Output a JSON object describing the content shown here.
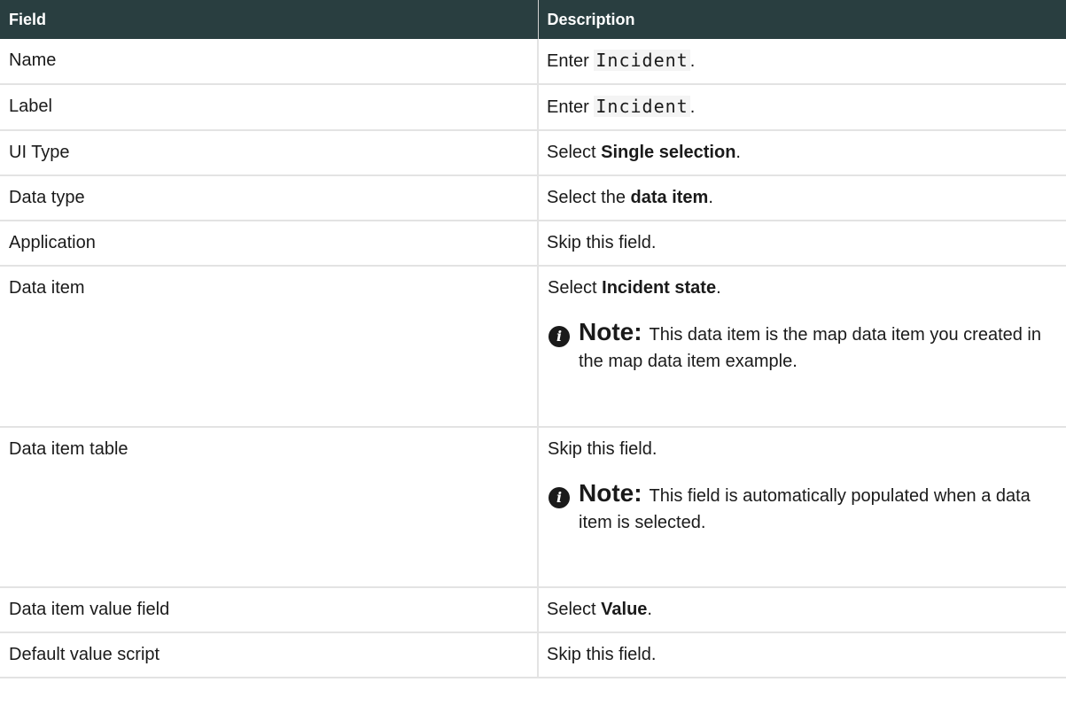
{
  "table": {
    "headers": {
      "field": "Field",
      "description": "Description"
    },
    "rows": [
      {
        "field": "Name",
        "pre": "Enter ",
        "code": "Incident",
        "post": "."
      },
      {
        "field": "Label",
        "pre": "Enter ",
        "code": "Incident",
        "post": "."
      },
      {
        "field": "UI Type",
        "pre": "Select ",
        "bold": "Single selection",
        "post": "."
      },
      {
        "field": "Data type",
        "pre": "Select the ",
        "bold": "data item",
        "post": "."
      },
      {
        "field": "Application",
        "text": "Skip this field."
      },
      {
        "field": "Data item",
        "pre": "Select ",
        "bold": "Incident state",
        "post": ".",
        "note": {
          "label": "Note:",
          "text": "This data item is the map data item you created in the map data item example."
        }
      },
      {
        "field": "Data item table",
        "text": "Skip this field.",
        "note": {
          "label": "Note:",
          "text": "This field is automatically populated when a data item is selected."
        }
      },
      {
        "field": "Data item value field",
        "pre": "Select ",
        "bold": "Value",
        "post": "."
      },
      {
        "field": "Default value script",
        "text": "Skip this field."
      }
    ]
  },
  "icons": {
    "note": "info-icon",
    "note_glyph": "i"
  }
}
